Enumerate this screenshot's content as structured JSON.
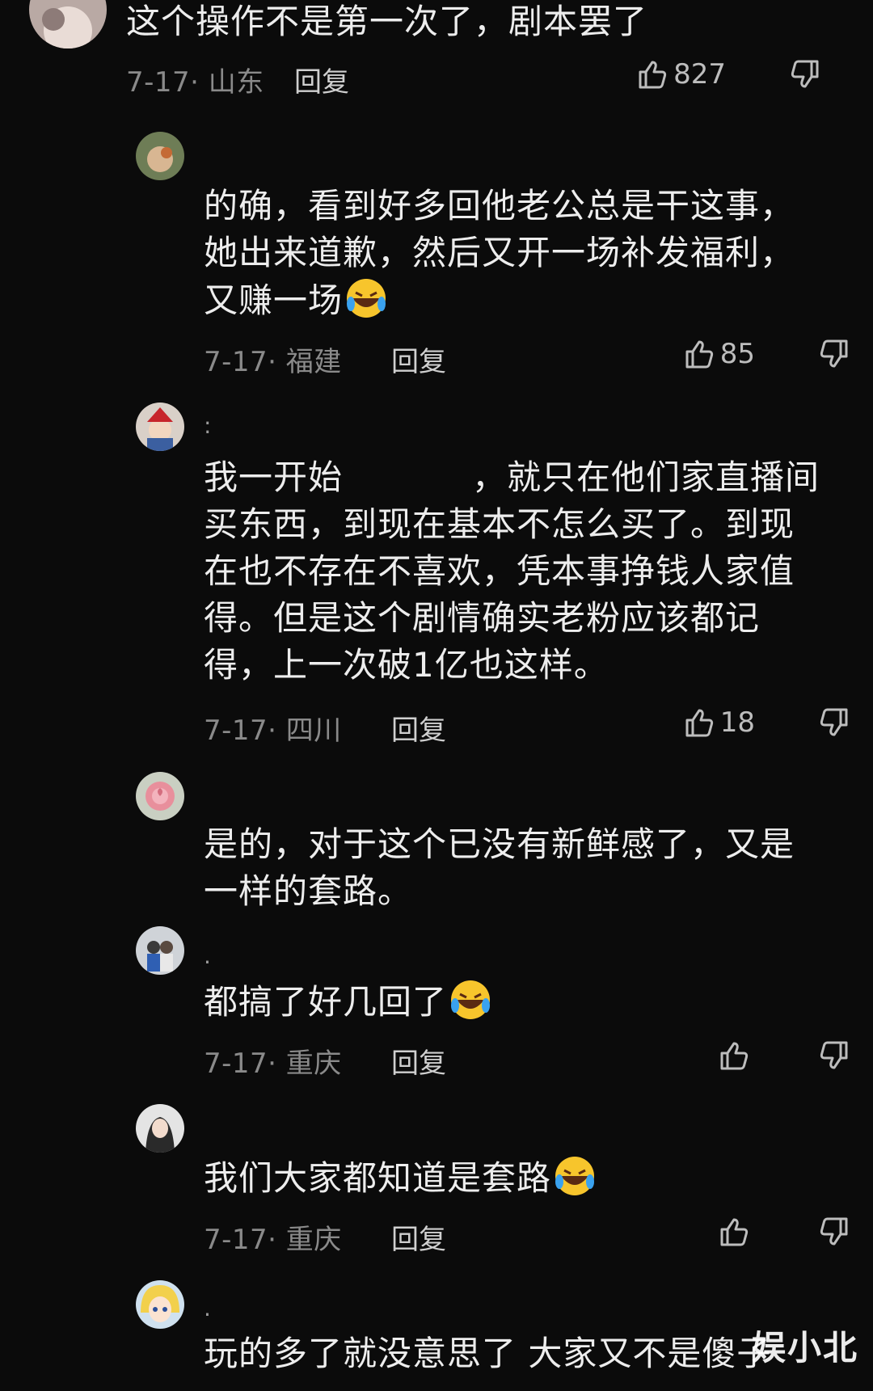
{
  "comments": [
    {
      "text": "这个操作不是第一次了，剧本罢了",
      "date": "7-17· 山东",
      "reply": "回复",
      "likes": "827"
    },
    {
      "text": "的确，看到好多回他老公总是干这事，\n她出来道歉，然后又开一场补发福利，\n又赚一场",
      "date": "7-17· 福建",
      "reply": "回复",
      "likes": "85"
    },
    {
      "username": ":",
      "text_a": "我一开始",
      "text_b": "，就只在他们家直播间\n买东西，到现在基本不怎么买了。到现\n在也不存在不喜欢，凭本事挣钱人家值\n得。但是这个剧情确实老粉应该都记\n得，上一次破1亿也这样。",
      "date": "7-17· 四川",
      "reply": "回复",
      "likes": "18"
    },
    {
      "text": "是的，对于这个已没有新鲜感了，又是\n一样的套路。"
    },
    {
      "username": ".",
      "text": "都搞了好几回了",
      "date": "7-17· 重庆",
      "reply": "回复",
      "likes": ""
    },
    {
      "text": "我们大家都知道是套路",
      "date": "7-17· 重庆",
      "reply": "回复",
      "likes": ""
    },
    {
      "username": ".",
      "text": "玩的多了就没意思了 大家又不是傻子"
    }
  ],
  "watermark": "娱小北",
  "icons": {
    "like": "thumbs-up-icon",
    "dislike": "thumbs-down-icon",
    "emoji": "laughing-crying-emoji"
  },
  "colors": {
    "background": "#0b0b0b",
    "text": "#ededed",
    "meta": "#8a8a8a"
  }
}
